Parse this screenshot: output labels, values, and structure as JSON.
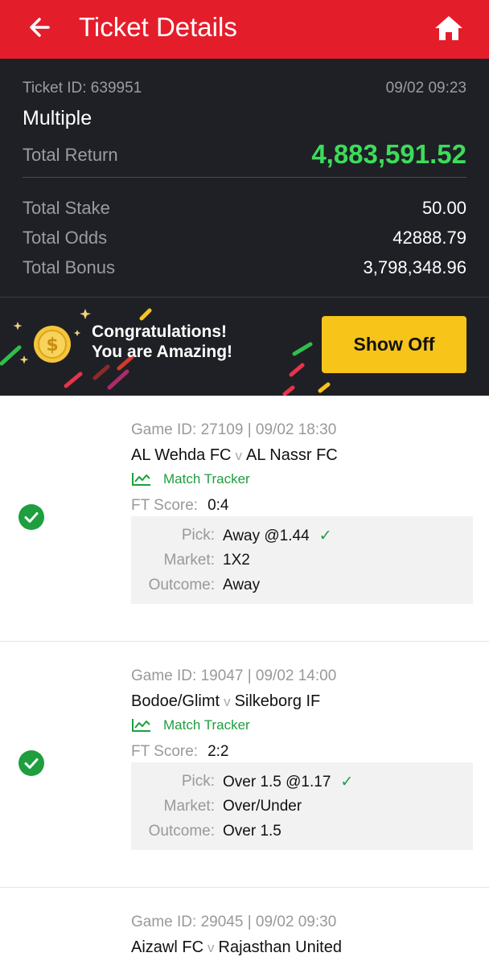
{
  "header": {
    "title": "Ticket Details",
    "back_icon": "arrow-left-icon",
    "home_icon": "home-icon",
    "bg": "#e41d2b"
  },
  "summary": {
    "ticket_id": "Ticket ID: 639951",
    "datetime": "09/02 09:23",
    "type": "Multiple",
    "total_return_label": "Total Return",
    "total_return": "4,883,591.52",
    "total_stake_label": "Total Stake",
    "total_stake": "50.00",
    "total_odds_label": "Total Odds",
    "total_odds": "42888.79",
    "total_bonus_label": "Total Bonus",
    "total_bonus": "3,798,348.96",
    "return_color": "#3ddc5a"
  },
  "banner": {
    "line1": "Congratulations!",
    "line2": "You are Amazing!",
    "button": "Show Off",
    "coin_icon": "gold-coin-icon",
    "button_color": "#f7c41a"
  },
  "bets": [
    {
      "game": "Game ID: 27109 | 09/02 18:30",
      "home": "AL Wehda FC",
      "away": "AL Nassr FC",
      "vs": "v",
      "tracker": "Match Tracker",
      "ft_label": "FT Score:",
      "ft": "0:4",
      "pick_label": "Pick:",
      "pick": "Away @1.44",
      "market_label": "Market:",
      "market": "1X2",
      "outcome_label": "Outcome:",
      "outcome": "Away",
      "tick": "✓"
    },
    {
      "game": "Game ID: 19047 | 09/02 14:00",
      "home": "Bodoe/Glimt",
      "away": "Silkeborg IF",
      "vs": "v",
      "tracker": "Match Tracker",
      "ft_label": "FT Score:",
      "ft": "2:2",
      "pick_label": "Pick:",
      "pick": "Over 1.5 @1.17",
      "market_label": "Market:",
      "market": "Over/Under",
      "outcome_label": "Outcome:",
      "outcome": "Over 1.5",
      "tick": "✓"
    },
    {
      "game": "Game ID: 29045 | 09/02 09:30",
      "home": "Aizawl FC",
      "away": "Rajasthan United",
      "vs": "v"
    }
  ]
}
